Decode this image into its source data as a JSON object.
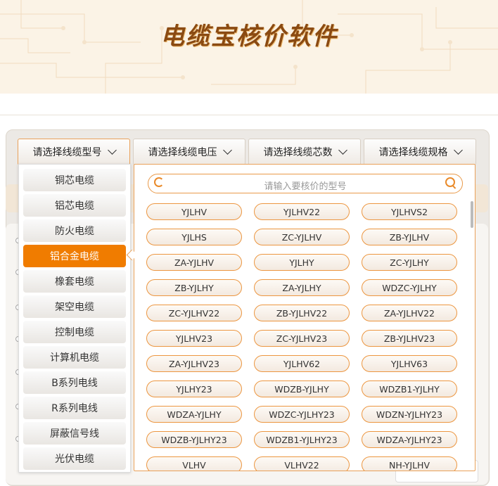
{
  "app": {
    "title": "电缆宝核价软件"
  },
  "dropdowns": [
    {
      "label": "请选择线缆型号"
    },
    {
      "label": "请选择线缆电压"
    },
    {
      "label": "请选择线缆芯数"
    },
    {
      "label": "请选择线缆规格"
    }
  ],
  "categories": [
    {
      "label": "铜芯电缆"
    },
    {
      "label": "铝芯电缆"
    },
    {
      "label": "防火电缆"
    },
    {
      "label": "铝合金电缆",
      "active": true
    },
    {
      "label": "橡套电缆"
    },
    {
      "label": "架空电缆"
    },
    {
      "label": "控制电缆"
    },
    {
      "label": "计算机电缆"
    },
    {
      "label": "B系列电线"
    },
    {
      "label": "R系列电线"
    },
    {
      "label": "屏蔽信号线"
    },
    {
      "label": "光伏电缆"
    }
  ],
  "search": {
    "placeholder": "请输入要核价的型号"
  },
  "models": [
    "YJLHV",
    "YJLHV22",
    "YJLHVS2",
    "YJLHS",
    "ZC-YJLHV",
    "ZB-YJLHV",
    "ZA-YJLHV",
    "YJLHY",
    "ZC-YJLHY",
    "ZB-YJLHY",
    "ZA-YJLHY",
    "WDZC-YJLHY",
    "ZC-YJLHV22",
    "ZB-YJLHV22",
    "ZA-YJLHV22",
    "YJLHV23",
    "ZC-YJLHV23",
    "ZB-YJLHV23",
    "ZA-YJLHV23",
    "YJLHV62",
    "YJLHV63",
    "YJLHY23",
    "WDZB-YJLHY",
    "WDZB1-YJLHY",
    "WDZA-YJLHY",
    "WDZC-YJLHY23",
    "WDZN-YJLHY23",
    "WDZB-YJLHY23",
    "WDZB1-YJLHY23",
    "WDZA-YJLHY23",
    "VLHV",
    "VLHV22",
    "NH-YJLHV"
  ],
  "colors": {
    "accent": "#f07c00",
    "border": "#ec9640",
    "banner_text": "#8a4a12"
  }
}
